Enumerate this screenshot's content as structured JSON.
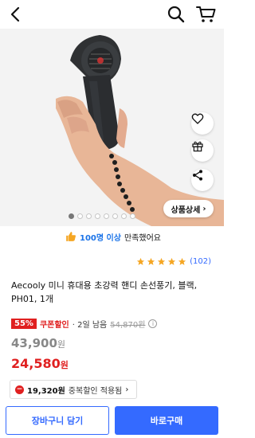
{
  "topbar": {
    "back_icon": "back-arrow-icon",
    "search_icon": "search-icon",
    "cart_icon": "cart-icon"
  },
  "hero": {
    "image": "handheld-fan-product-photo",
    "side_actions": [
      "heart-icon",
      "gift-icon",
      "share-icon"
    ],
    "detail_button_label": "상품상세",
    "carousel": {
      "total": 8,
      "active": 0
    }
  },
  "satisfaction": {
    "count": "100명 이상",
    "text": "만족했어요"
  },
  "rating": {
    "stars": 5,
    "count": "(102)"
  },
  "product": {
    "title": "Aecooly 미니 휴대용 초강력 핸디 손선풍기, 블랙, PH01, 1개"
  },
  "pricing": {
    "discount_badge": "55%",
    "coupon_label": "쿠폰할인",
    "delivery": "· 2일 남음",
    "original_price": "54,870원",
    "list_price": "43,900",
    "sale_price": "24,580",
    "currency": "원"
  },
  "duplicate_discount": {
    "amount": "19,320원",
    "text": "중복할인 적용됨"
  },
  "actions": {
    "cart_label": "장바구니 담기",
    "buy_label": "바로구매"
  },
  "colors": {
    "accent": "#346aff",
    "sale": "#e02020",
    "star": "#f5a623"
  }
}
